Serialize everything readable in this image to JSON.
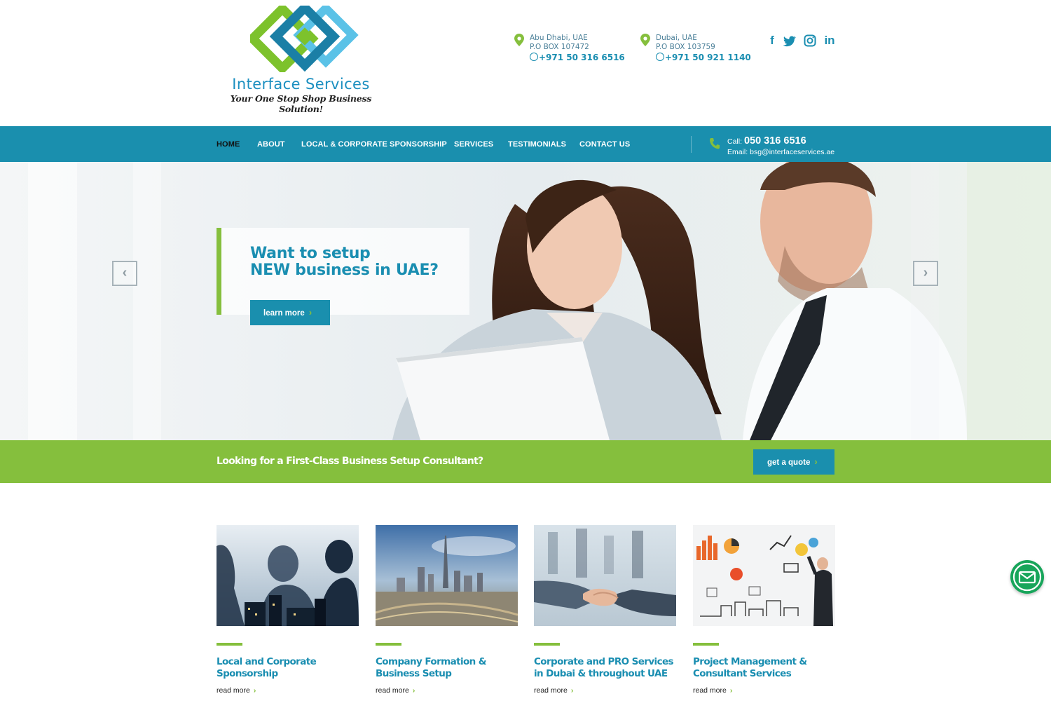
{
  "brand": {
    "name": "Interface Services",
    "tagline": "Your One Stop Shop Business Solution!",
    "colors": {
      "primary": "#1a8fae",
      "accent": "#85bf3d",
      "text_blue": "#1a8eb1"
    }
  },
  "offices": [
    {
      "city": "Abu Dhabi, UAE",
      "pobox": "P.O BOX 107472",
      "phone": "+971 50 316 6516",
      "icon": "location-pin-icon"
    },
    {
      "city": "Dubai, UAE",
      "pobox": "P.O BOX 103759",
      "phone": "+971 50 921 1140",
      "icon": "location-pin-icon"
    }
  ],
  "social": [
    {
      "name": "facebook-icon",
      "glyph": "f"
    },
    {
      "name": "twitter-icon",
      "glyph": "t"
    },
    {
      "name": "instagram-icon",
      "glyph": ""
    },
    {
      "name": "linkedin-icon",
      "glyph": "in"
    }
  ],
  "nav": {
    "items": [
      {
        "label": "HOME",
        "active": true
      },
      {
        "label": "ABOUT",
        "active": false
      },
      {
        "label": "LOCAL & CORPORATE SPONSORSHIP",
        "active": false
      },
      {
        "label": "SERVICES",
        "active": false
      },
      {
        "label": "TESTIMONIALS",
        "active": false
      },
      {
        "label": "CONTACT US",
        "active": false
      }
    ],
    "call_label": "Call:",
    "call_number": "050 316 6516",
    "email_label": "Email:",
    "email": "bsg@interfaceservices.ae"
  },
  "hero": {
    "title_line1": "Want to setup",
    "title_line2": "NEW business in UAE?",
    "button_label": "learn more",
    "prev_icon": "chevron-left-icon",
    "next_icon": "chevron-right-icon"
  },
  "cta": {
    "text": "Looking for a First-Class Business Setup Consultant?",
    "button_label": "get a quote"
  },
  "cards": [
    {
      "title_line1": "Local and Corporate",
      "title_line2": "Sponsorship",
      "more": "read more"
    },
    {
      "title_line1": "Company Formation &",
      "title_line2": "Business Setup",
      "more": "read more"
    },
    {
      "title_line1": "Corporate and PRO Services",
      "title_line2": "in Dubai & throughout UAE",
      "more": "read more"
    },
    {
      "title_line1": "Project Management &",
      "title_line2": "Consultant Services",
      "more": "read more"
    }
  ],
  "fab": {
    "icon": "mail-icon"
  }
}
